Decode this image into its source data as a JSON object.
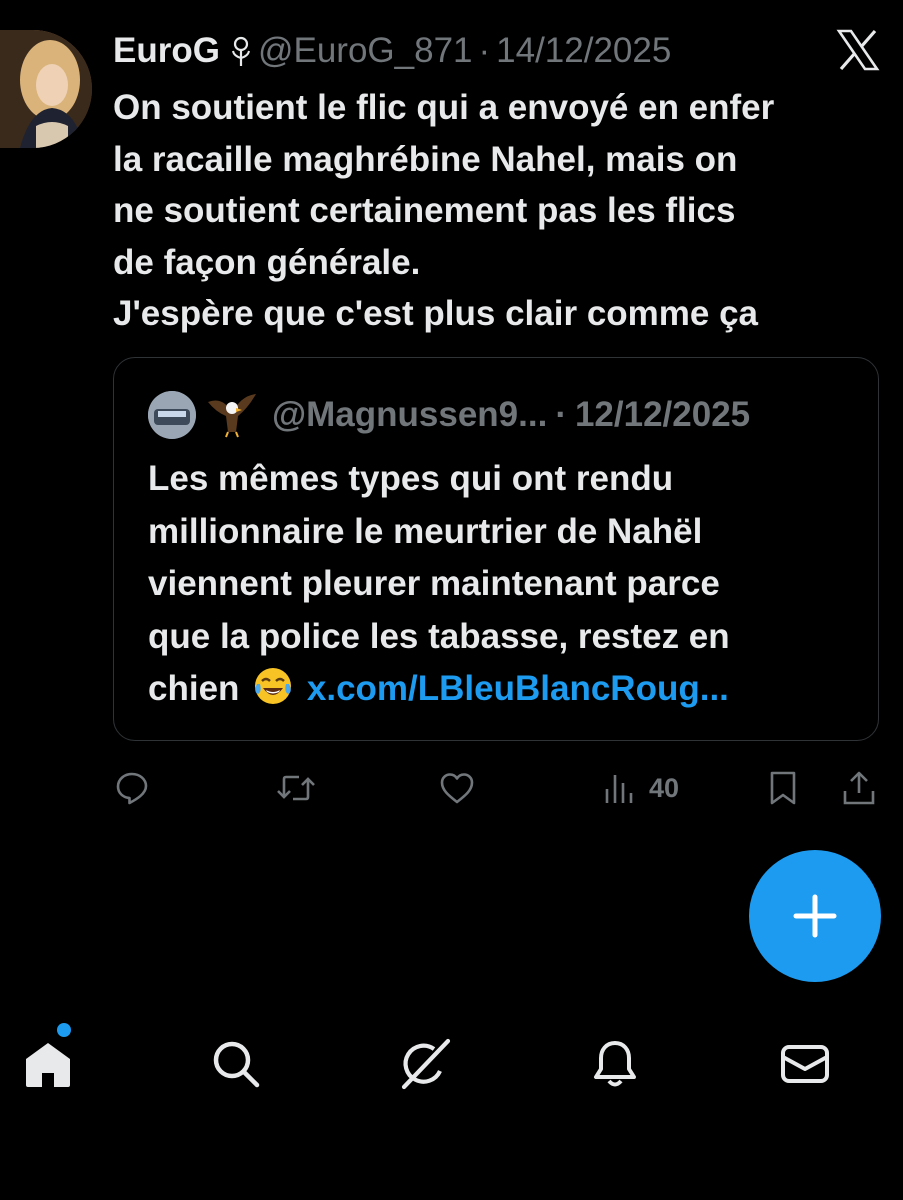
{
  "post": {
    "display_name": "EuroG",
    "badge_icon": "rose-icon",
    "handle": "@EuroG_871",
    "separator": "·",
    "date": "14/12/2025",
    "text_lines": [
      "On soutient le flic qui a envoyé en enfer",
      "la racaille maghrébine Nahel, mais on",
      "ne soutient certainement pas les flics",
      "de façon générale.",
      "J'espère que c'est plus clair comme ça"
    ]
  },
  "quoted_post": {
    "handle": "@Magnussen9...",
    "name_emoji": "eagle-emoji",
    "separator": "·",
    "date": "12/12/2025",
    "text_lines": [
      "Les mêmes types qui ont rendu",
      "millionnaire le meurtrier de Nahël",
      "viennent pleurer maintenant parce",
      "que la police les tabasse, restez en"
    ],
    "last_line_text": "chien",
    "last_line_emoji": "laughing-tears-emoji",
    "link_text": "x.com/LBleuBlancRoug..."
  },
  "actions": {
    "views_count": "40",
    "icons": [
      "reply-icon",
      "retweet-icon",
      "like-icon",
      "views-icon",
      "bookmark-icon",
      "share-icon"
    ]
  },
  "compose_button": {
    "icon": "plus-icon"
  },
  "bottom_nav": {
    "items": [
      "home-icon",
      "search-icon",
      "grok-icon",
      "notifications-icon",
      "messages-icon"
    ]
  },
  "colors": {
    "background": "#000000",
    "text": "#e7e9ea",
    "secondary": "#71767b",
    "accent": "#1d9bf0",
    "border": "#2f3336"
  }
}
